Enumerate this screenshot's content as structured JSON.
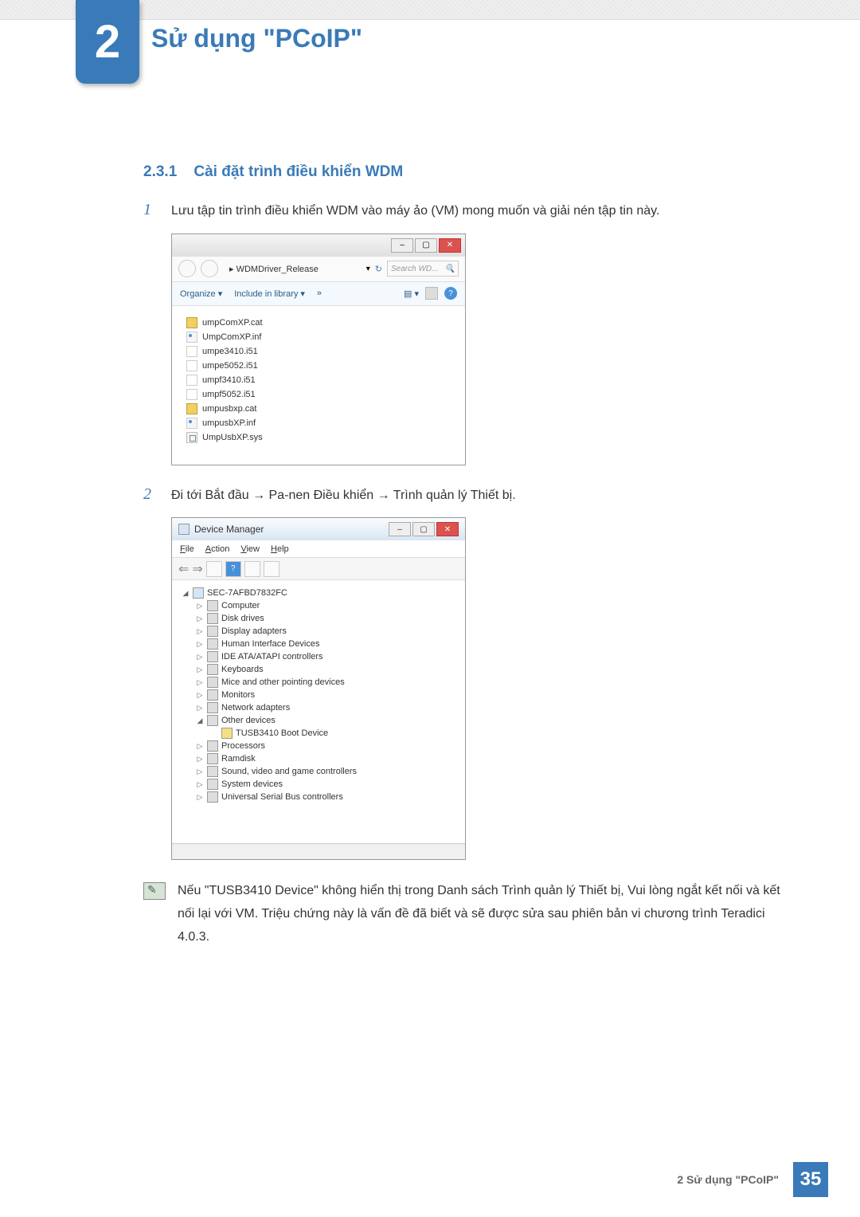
{
  "chapter": {
    "number": "2",
    "title": "Sử dụng \"PCoIP\""
  },
  "section": {
    "number": "2.3.1",
    "title": "Cài đặt trình điều khiển WDM"
  },
  "steps": {
    "s1": {
      "num": "1",
      "text": "Lưu tập tin trình điều khiển WDM vào máy ảo (VM) mong muốn và giải nén tập tin này."
    },
    "s2": {
      "num": "2",
      "text": "Đi tới Bắt đầu → Pa-nen Điều khiển → Trình quản lý Thiết bị."
    }
  },
  "explorer": {
    "breadcrumb": "▸ WDMDriver_Release",
    "search_placeholder": "Search WD...",
    "toolbar": {
      "organize": "Organize ▾",
      "include": "Include in library ▾",
      "more": "»"
    },
    "files": [
      {
        "name": "umpComXP.cat",
        "type": "cat"
      },
      {
        "name": "UmpComXP.inf",
        "type": "inf"
      },
      {
        "name": "umpe3410.i51",
        "type": "i51"
      },
      {
        "name": "umpe5052.i51",
        "type": "i51"
      },
      {
        "name": "umpf3410.i51",
        "type": "i51"
      },
      {
        "name": "umpf5052.i51",
        "type": "i51"
      },
      {
        "name": "umpusbxp.cat",
        "type": "cat"
      },
      {
        "name": "umpusbXP.inf",
        "type": "inf"
      },
      {
        "name": "UmpUsbXP.sys",
        "type": "sys"
      }
    ]
  },
  "devmgr": {
    "title": "Device Manager",
    "menu": {
      "file": "File",
      "action": "Action",
      "view": "View",
      "help": "Help"
    },
    "root": "SEC-7AFBD7832FC",
    "items": [
      "Computer",
      "Disk drives",
      "Display adapters",
      "Human Interface Devices",
      "IDE ATA/ATAPI controllers",
      "Keyboards",
      "Mice and other pointing devices",
      "Monitors",
      "Network adapters",
      "Other devices"
    ],
    "warn_item": "TUSB3410 Boot Device",
    "items2": [
      "Processors",
      "Ramdisk",
      "Sound, video and game controllers",
      "System devices",
      "Universal Serial Bus controllers"
    ]
  },
  "note": "Nếu \"TUSB3410 Device\" không hiển thị trong Danh sách Trình quản lý Thiết bị, Vui lòng ngắt kết nối và kết nối lại với VM. Triệu chứng này là vấn đề đã biết và sẽ được sửa sau phiên bản vi chương trình Teradici 4.0.3.",
  "footer": {
    "text": "2 Sử dụng \"PCoIP\"",
    "page": "35"
  }
}
